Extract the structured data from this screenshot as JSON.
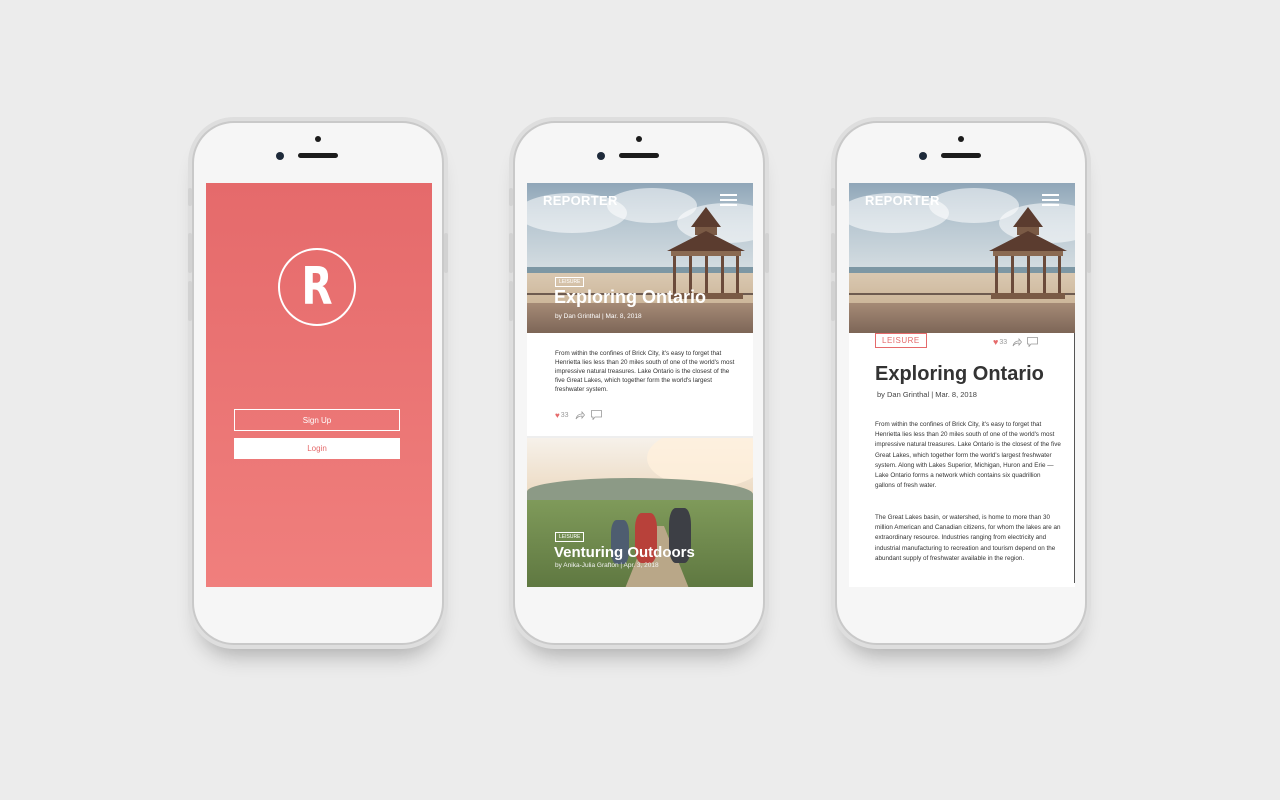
{
  "login": {
    "logo_letter": "R",
    "signup_label": "Sign Up",
    "login_label": "Login",
    "bg_color": "#e56a6b"
  },
  "feed": {
    "brand": "REPORTER",
    "articles": [
      {
        "tag": "LEISURE",
        "title": "Exploring Ontario",
        "meta": "by Dan Grinthal | Mar. 8, 2018",
        "excerpt": "From within the confines of Brick City, it's easy to forget that Henrietta lies less than 20 miles south of one of the world's most impressive natural treasures. Lake Ontario is the closest of the five Great Lakes, which together form the world's largest freshwater system.",
        "likes": "33"
      },
      {
        "tag": "LEISURE",
        "title": "Venturing Outdoors",
        "meta": "by Anika-Julia Grafton | Apr. 3, 2018"
      }
    ]
  },
  "article": {
    "brand": "REPORTER",
    "tag": "LEISURE",
    "likes": "33",
    "title": "Exploring Ontario",
    "meta": "by Dan Grinthal | Mar. 8, 2018",
    "paragraph1": "From within the confines of Brick City, it's easy to forget that Henrietta lies less than 20 miles south of one of the world's most impressive natural treasures. Lake Ontario is the closest of the five Great Lakes, which together form the world's largest freshwater system. Along with Lakes Superior, Michigan, Huron and Erie — Lake Ontario forms a network which contains six quadrillion gallons of fresh water.",
    "paragraph2": "The Great Lakes basin, or watershed, is home to more than 30 million American and Canadian citizens, for whom the lakes are an extraordinary resource. Industries ranging from electricity and industrial manufacturing to recreation and tourism depend on the abundant supply of freshwater available in the region."
  },
  "icons": [
    "heart-icon",
    "share-icon",
    "comment-icon",
    "menu-icon"
  ],
  "colors": {
    "accent": "#e56a6b",
    "background": "#ececec"
  }
}
